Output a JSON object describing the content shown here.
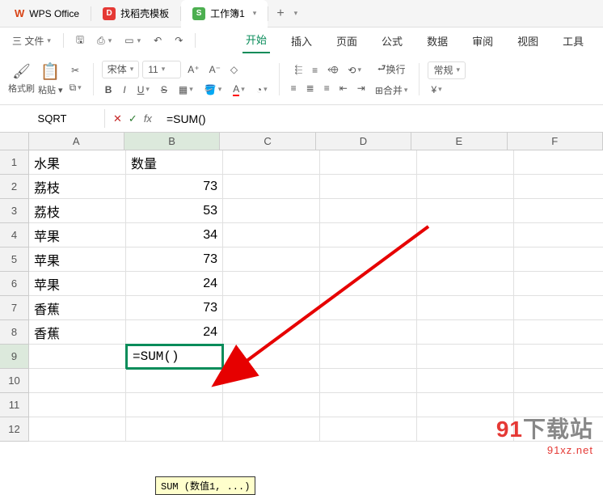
{
  "titlebar": {
    "app_name": "WPS Office",
    "tabs": [
      {
        "icon": "D",
        "label": "找稻壳模板"
      },
      {
        "icon": "S",
        "label": "工作簿1"
      }
    ]
  },
  "quickbar": {
    "file_menu": "三 文件"
  },
  "menu": {
    "start": "开始",
    "insert": "插入",
    "page": "页面",
    "formula": "公式",
    "data": "数据",
    "review": "审阅",
    "view": "视图",
    "tools": "工具"
  },
  "ribbon": {
    "format_painter": "格式刷",
    "paste": "粘贴",
    "font_name": "宋体",
    "font_size": "11",
    "wrap": "换行",
    "merge": "合并",
    "general_fmt": "常规",
    "currency_prefix": "¥"
  },
  "formula_bar": {
    "namebox": "SQRT",
    "fx": "fx",
    "content": "=SUM()"
  },
  "columns": [
    "A",
    "B",
    "C",
    "D",
    "E",
    "F"
  ],
  "rows": [
    "1",
    "2",
    "3",
    "4",
    "5",
    "6",
    "7",
    "8",
    "9",
    "10",
    "11",
    "12"
  ],
  "sheet": {
    "a1": "水果",
    "b1": "数量",
    "a2": "荔枝",
    "b2": "73",
    "a3": "荔枝",
    "b3": "53",
    "a4": "苹果",
    "b4": "34",
    "a5": "苹果",
    "b5": "73",
    "a6": "苹果",
    "b6": "24",
    "a7": "香蕉",
    "b7": "73",
    "a8": "香蕉",
    "b8": "24",
    "b9": "=SUM()"
  },
  "tooltip": "SUM (数值1, ...)",
  "watermark": {
    "brand_num": "91",
    "brand_text": "下载站",
    "url": "91xz.net"
  },
  "chart_data": {
    "type": "table",
    "columns": [
      "水果",
      "数量"
    ],
    "rows": [
      [
        "荔枝",
        73
      ],
      [
        "荔枝",
        53
      ],
      [
        "苹果",
        34
      ],
      [
        "苹果",
        73
      ],
      [
        "苹果",
        24
      ],
      [
        "香蕉",
        73
      ],
      [
        "香蕉",
        24
      ]
    ]
  }
}
